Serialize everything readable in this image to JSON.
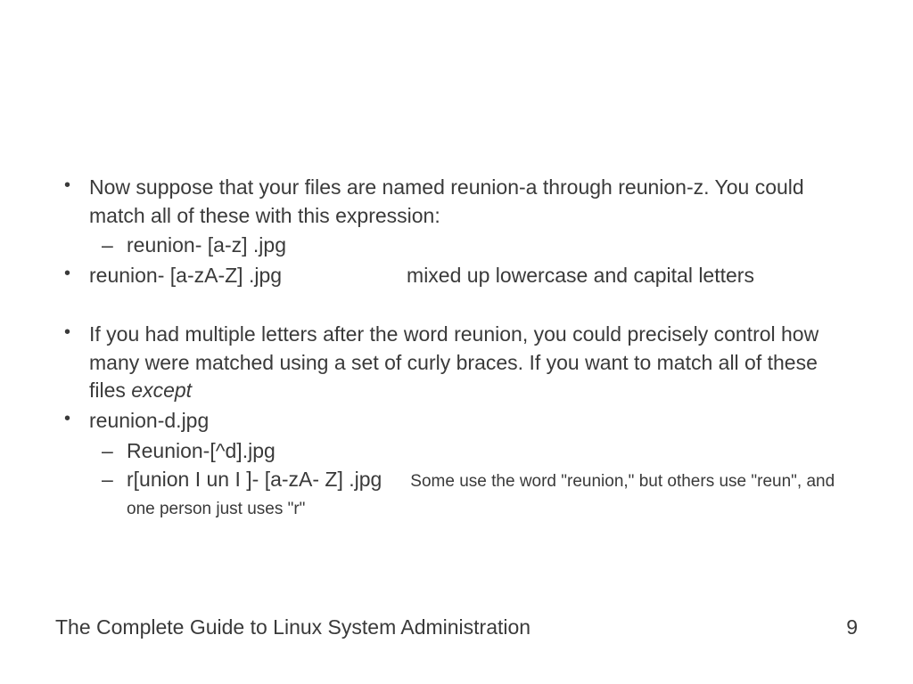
{
  "bullets": {
    "b1": "Now suppose that your files are named reunion-a through reunion-z. You could match all of these with this expression:",
    "b1_sub1": "reunion- [a-z] .jpg",
    "b2_left": "reunion- [a-zA-Z] .jpg",
    "b2_right": "mixed up lowercase and capital letters",
    "b3_a": "If you had multiple letters after the word reunion, you could precisely control how many were matched using a set of curly braces. If you want to match all of these files ",
    "b3_ital": "except",
    "b4": "reunion-d.jpg",
    "b4_sub1": "Reunion-[^d].jpg",
    "b4_sub2_left": "r[union I un I ]- [a-zA- Z] .jpg",
    "b4_sub2_right": "Some use the word \"reunion,\" but others use \"reun\", and one person just uses \"r\""
  },
  "footer": {
    "title": "The Complete Guide to Linux System Administration",
    "page": "9"
  }
}
